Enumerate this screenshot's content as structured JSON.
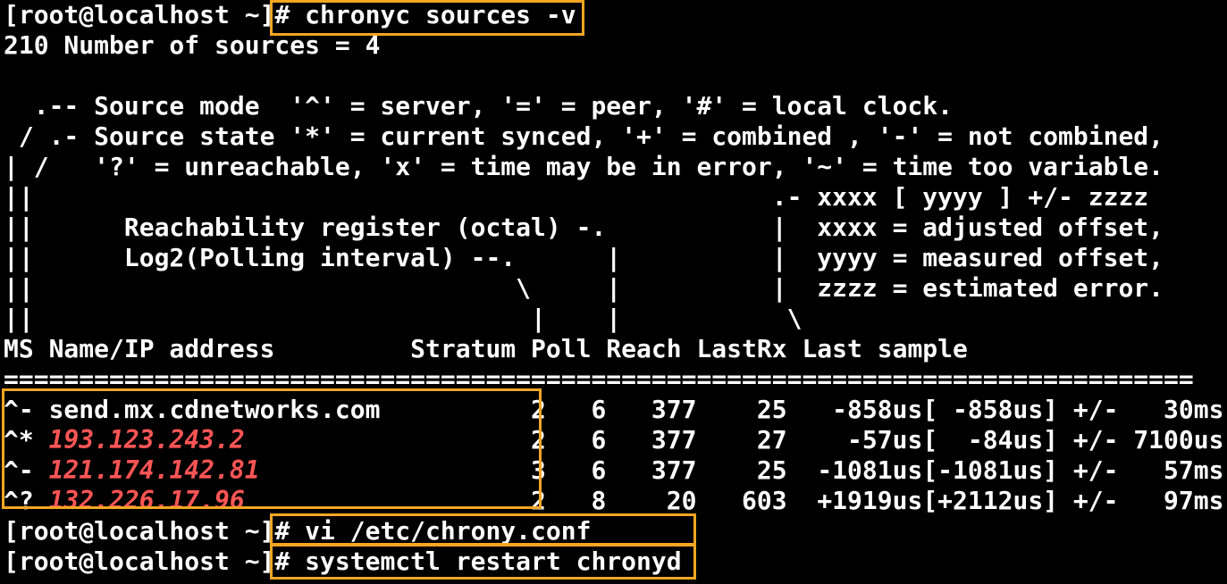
{
  "prompt": "[root@localhost ~]",
  "commands": {
    "first": "# chronyc sources -v",
    "second": "# vi /etc/chrony.conf",
    "third": "# systemctl restart chronyd"
  },
  "output": {
    "count_line": "210 Number of sources = 4",
    "legend": [
      "  .-- Source mode  '^' = server, '=' = peer, '#' = local clock.",
      " / .- Source state '*' = current synced, '+' = combined , '-' = not combined,",
      "| /   '?' = unreachable, 'x' = time may be in error, '~' = time too variable.",
      "||                                                 .- xxxx [ yyyy ] +/- zzzz",
      "||      Reachability register (octal) -.           |  xxxx = adjusted offset,",
      "||      Log2(Polling interval) --.      |          |  yyyy = measured offset,",
      "||                                \\     |          |  zzzz = estimated error.",
      "||                                 |    |           \\"
    ],
    "header": "MS Name/IP address         Stratum Poll Reach LastRx Last sample",
    "separator": "===============================================================================",
    "rows": [
      {
        "ms": "^-",
        "name": "send.mx.cdnetworks.com",
        "red": false,
        "rest": "          2   6   377    25   -858us[ -858us] +/-   30ms"
      },
      {
        "ms": "^*",
        "name": "193.123.243.2",
        "red": true,
        "rest": "                   2   6   377    27    -57us[  -84us] +/- 7100us"
      },
      {
        "ms": "^-",
        "name": "121.174.142.81",
        "red": true,
        "rest": "                  3   6   377    25  -1081us[-1081us] +/-   57ms"
      },
      {
        "ms": "^?",
        "name": "132.226.17.96",
        "red": true,
        "rest": "                   2   8    20   603  +1919us[+2112us] +/-   97ms"
      }
    ]
  },
  "colors": {
    "background": "#000000",
    "text": "#ffffff",
    "highlight": "#f5a623",
    "ip_red": "#ff5555"
  }
}
